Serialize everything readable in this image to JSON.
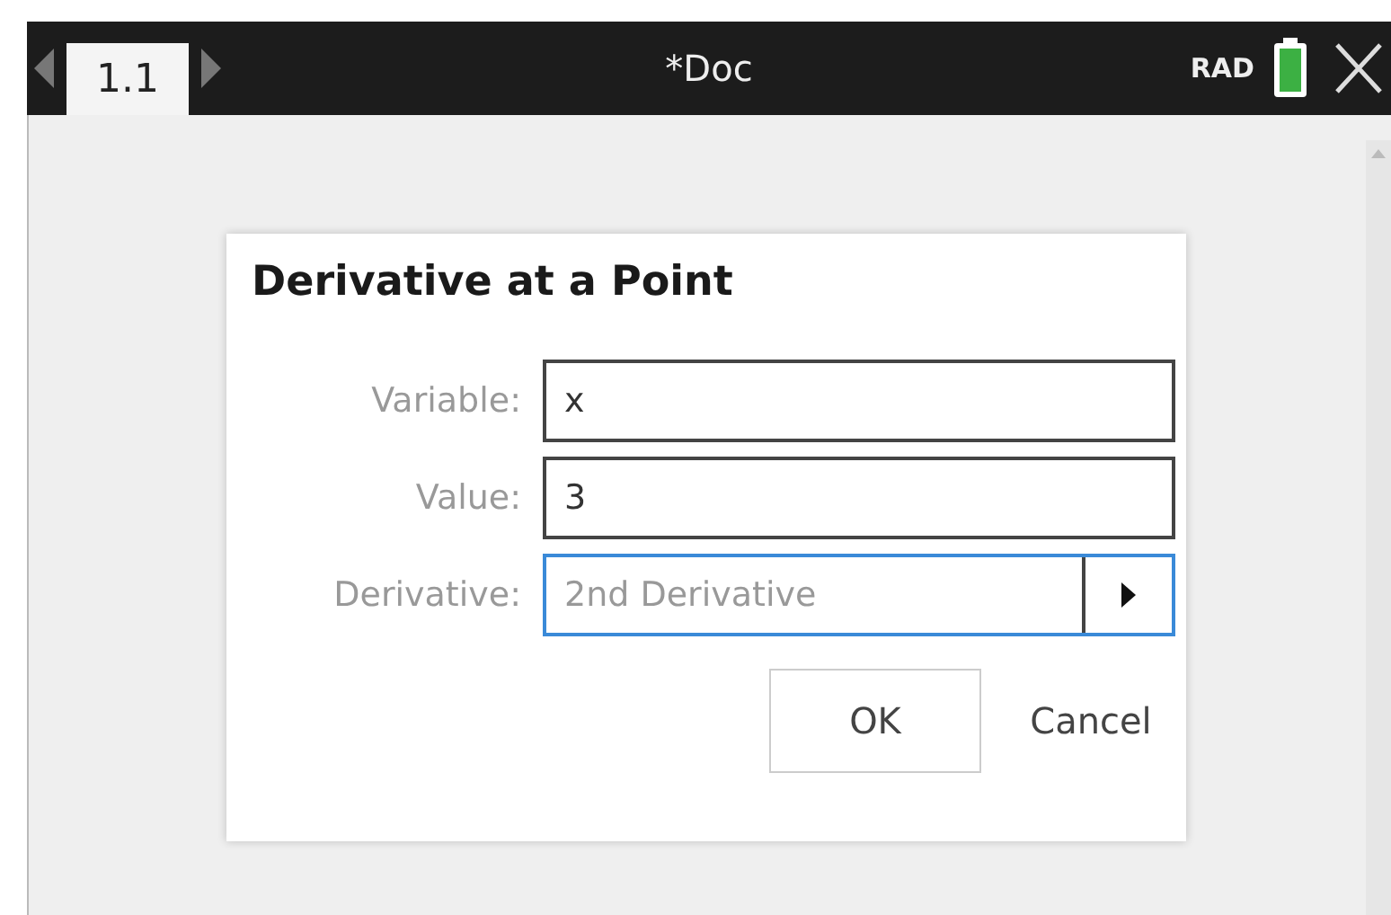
{
  "top_bar": {
    "page_tab": {
      "label": "1.1",
      "selected": true
    },
    "title": "*Doc",
    "mode": "RAD"
  },
  "dialog": {
    "title": "Derivative at a Point",
    "fields": [
      {
        "kind": "text",
        "label": "Variable:",
        "value": "x",
        "focused": false
      },
      {
        "kind": "text",
        "label": "Value:",
        "value": "3",
        "focused": false
      },
      {
        "kind": "dropdown",
        "label": "Derivative:",
        "value": "2nd Derivative",
        "focused": true
      }
    ],
    "buttons": [
      {
        "label": "OK",
        "kind": "default"
      },
      {
        "label": "Cancel",
        "kind": "plain"
      }
    ]
  }
}
